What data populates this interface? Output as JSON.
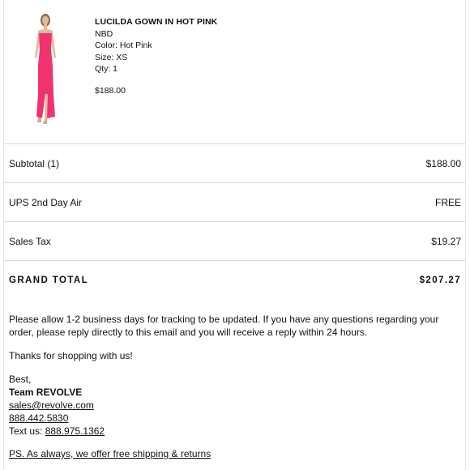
{
  "item": {
    "name": "LUCILDA GOWN IN HOT PINK",
    "brand": "NBD",
    "color": "Color: Hot Pink",
    "size": "Size: XS",
    "qty": "Qty: 1",
    "price": "$188.00",
    "image_color": "#f0336f"
  },
  "summary": {
    "subtotal_label": "Subtotal (1)",
    "subtotal_value": "$188.00",
    "shipping_label": "UPS 2nd Day Air",
    "shipping_value": "FREE",
    "tax_label": "Sales Tax",
    "tax_value": "$19.27",
    "total_label": "GRAND TOTAL",
    "total_value": "$207.27"
  },
  "message": {
    "tracking_note": "Please allow 1-2 business days for tracking to be updated. If you have any questions regarding your order, please reply directly to this email and you will receive a reply within 24 hours.",
    "thanks": "Thanks for shopping with us!",
    "closing": "Best,",
    "team": "Team REVOLVE",
    "email": "sales@revolve.com",
    "phone": "888.442.5830",
    "text_prefix": "Text us: ",
    "text_number": "888.975.1362",
    "ps": "PS. As always, we offer free shipping & returns"
  }
}
